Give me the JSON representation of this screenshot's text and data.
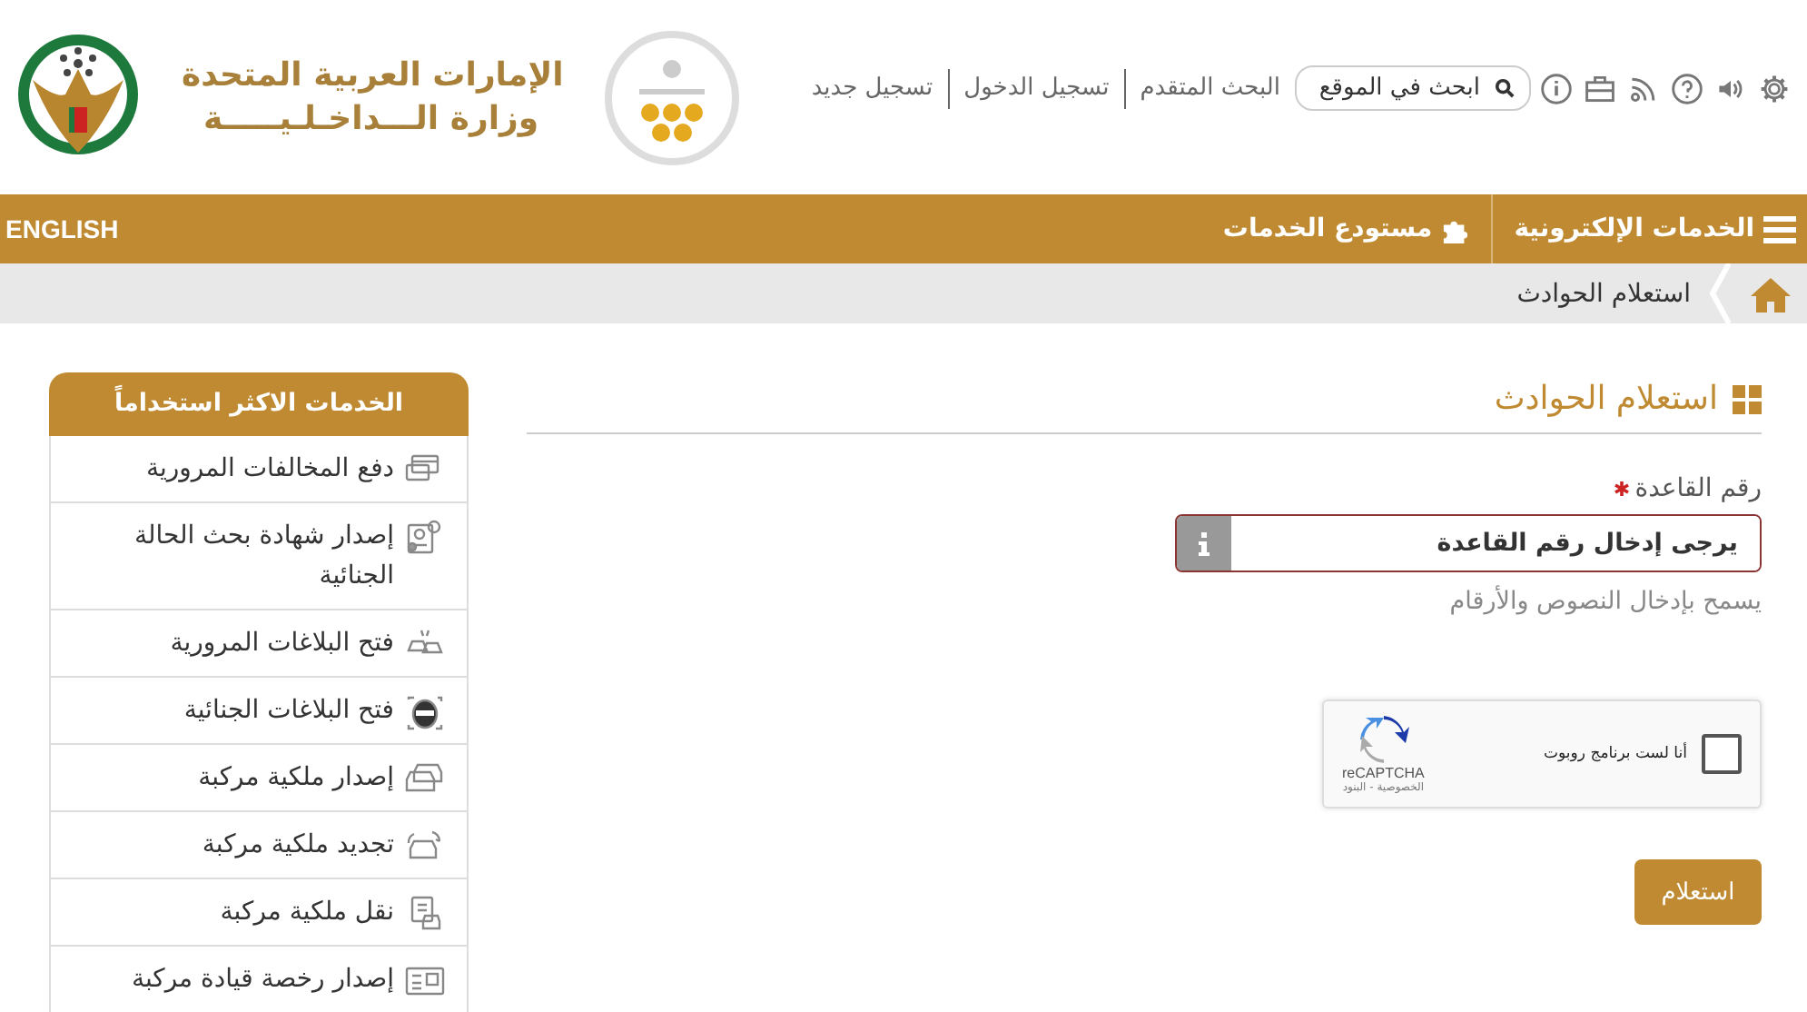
{
  "header": {
    "ministry_name": [
      "الإمارات العربية المتحدة",
      "وزارة الـــداخـلـيـــــة"
    ],
    "search": {
      "placeholder": "ابحث في الموقع"
    },
    "links": [
      "البحث المتقدم",
      "تسجيل الدخول",
      "تسجيل جديد"
    ]
  },
  "nav": {
    "items": [
      {
        "label": "الخدمات الإلكترونية",
        "kind": "menu"
      },
      {
        "label": "مستودع الخدمات",
        "kind": "puzzle"
      }
    ],
    "language": "ENGLISH"
  },
  "breadcrumb": {
    "current": "استعلام الحوادث"
  },
  "sidebar": {
    "title": "الخدمات الاكثر استخداماً",
    "items": [
      {
        "label": "دفع المخالفات المرورية",
        "kind": "card"
      },
      {
        "label": "إصدار شهادة بحث الحالة الجنائية",
        "kind": "certificate"
      },
      {
        "label": "فتح البلاغات المرورية",
        "kind": "crash"
      },
      {
        "label": "فتح البلاغات الجنائية",
        "kind": "mask"
      },
      {
        "label": "إصدار ملكية مركبة",
        "kind": "car"
      },
      {
        "label": "تجديد ملكية مركبة",
        "kind": "renew"
      },
      {
        "label": "نقل ملكية مركبة",
        "kind": "transfer"
      },
      {
        "label": "إصدار رخصة قيادة مركبة",
        "kind": "license"
      }
    ]
  },
  "page_title": "استعلام الحوادث",
  "form": {
    "label": "رقم القاعدة",
    "required": true,
    "placeholder": "يرجى إدخال رقم القاعدة",
    "hint": "يسمح بإدخال النصوص والأرقام",
    "captcha": {
      "label": "أنا لست برنامج روبوت",
      "checked": false,
      "brand": "reCAPTCHA",
      "terms": "الخصوصية - البنود"
    },
    "submit": "استعلام"
  }
}
